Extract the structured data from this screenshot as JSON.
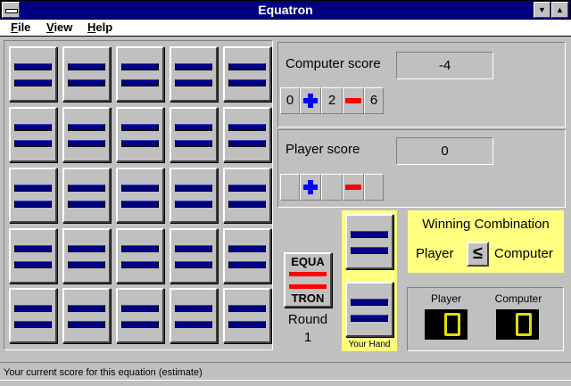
{
  "window": {
    "title": "Equatron"
  },
  "menu": [
    {
      "label": "File",
      "hotkey": "F",
      "rest": "ile"
    },
    {
      "label": "View",
      "hotkey": "V",
      "rest": "iew"
    },
    {
      "label": "Help",
      "hotkey": "H",
      "rest": "elp"
    }
  ],
  "computer": {
    "score_label": "Computer score",
    "score": "-4",
    "equation": {
      "a": "0",
      "b": "2",
      "c": "6"
    }
  },
  "player": {
    "score_label": "Player score",
    "score": "0"
  },
  "logo": {
    "line1": "EQUA",
    "line2": "TRON"
  },
  "round": {
    "label": "Round",
    "number": "1"
  },
  "hand": {
    "label": "Your Hand"
  },
  "winning": {
    "title": "Winning Combination",
    "left": "Player",
    "operator": "≤",
    "right": "Computer"
  },
  "tally": {
    "player_label": "Player",
    "computer_label": "Computer",
    "player_wins": 0,
    "computer_wins": 0
  },
  "status": {
    "text": "Your current score for this equation (estimate)"
  },
  "colors": {
    "titlebar": "#000080",
    "tile_bar": "#000080",
    "plus": "#0000ff",
    "minus": "#ff0000",
    "highlight": "#ffff80",
    "led": "#e0e000"
  },
  "icons": {
    "operator_plus": "plus-icon",
    "operator_minus": "minus-icon"
  }
}
